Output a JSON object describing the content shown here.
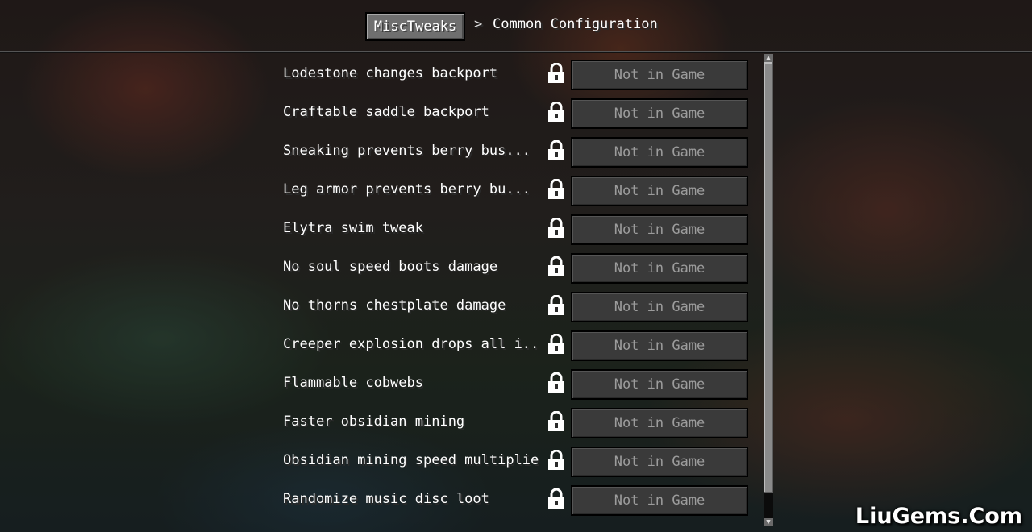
{
  "header": {
    "breadcrumb_root": "MiscTweaks",
    "separator": ">",
    "breadcrumb_current": "Common Configuration"
  },
  "rows": [
    {
      "label": "Lodestone changes backport",
      "value": "Not in Game"
    },
    {
      "label": "Craftable saddle backport",
      "value": "Not in Game"
    },
    {
      "label": "Sneaking prevents berry bus...",
      "value": "Not in Game"
    },
    {
      "label": "Leg armor prevents berry bu...",
      "value": "Not in Game"
    },
    {
      "label": "Elytra swim tweak",
      "value": "Not in Game"
    },
    {
      "label": "No soul speed boots damage",
      "value": "Not in Game"
    },
    {
      "label": "No thorns chestplate damage",
      "value": "Not in Game"
    },
    {
      "label": "Creeper explosion drops all i...",
      "value": "Not in Game"
    },
    {
      "label": "Flammable cobwebs",
      "value": "Not in Game"
    },
    {
      "label": "Faster obsidian mining",
      "value": "Not in Game"
    },
    {
      "label": "Obsidian mining speed multiplier",
      "value": "Not in Game"
    },
    {
      "label": "Randomize music disc loot",
      "value": "Not in Game"
    }
  ],
  "icons": {
    "row_lock": "lock-icon"
  },
  "colors": {
    "text": "#ffffff",
    "disabled_button_text": "#9c9c9c",
    "disabled_button_bg": "#3a3a3a"
  },
  "watermark": "LiuGems.Com"
}
